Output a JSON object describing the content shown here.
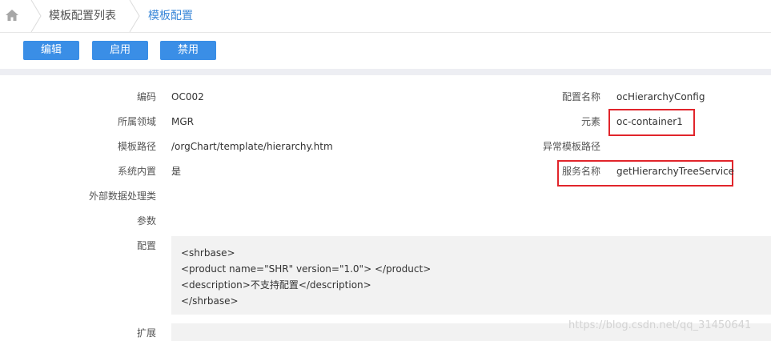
{
  "breadcrumb": {
    "home_icon": "home-icon",
    "items": [
      "模板配置列表",
      "模板配置"
    ]
  },
  "toolbar": {
    "edit_label": "编辑",
    "enable_label": "启用",
    "disable_label": "禁用",
    "accent": "#3a8ee6"
  },
  "form": {
    "left": [
      {
        "label": "编码",
        "value": "OC002"
      },
      {
        "label": "所属领域",
        "value": "MGR"
      },
      {
        "label": "模板路径",
        "value": "/orgChart/template/hierarchy.htm"
      },
      {
        "label": "系统内置",
        "value": "是"
      },
      {
        "label": "外部数据处理类",
        "value": ""
      },
      {
        "label": "参数",
        "value": ""
      }
    ],
    "right": [
      {
        "label": "配置名称",
        "value": "ocHierarchyConfig"
      },
      {
        "label": "元素",
        "value": "oc-container1"
      },
      {
        "label": "异常模板路径",
        "value": ""
      },
      {
        "label": "服务名称",
        "value": "getHierarchyTreeService"
      }
    ],
    "config_label": "配置",
    "config_lines": [
      "<shrbase>",
      "<product name=\"SHR\" version=\"1.0\"> </product>",
      "<description>不支持配置</description>",
      "</shrbase>"
    ],
    "extension_label": "扩展"
  },
  "highlight_color": "#e1252b",
  "watermark": "https://blog.csdn.net/qq_31450641"
}
